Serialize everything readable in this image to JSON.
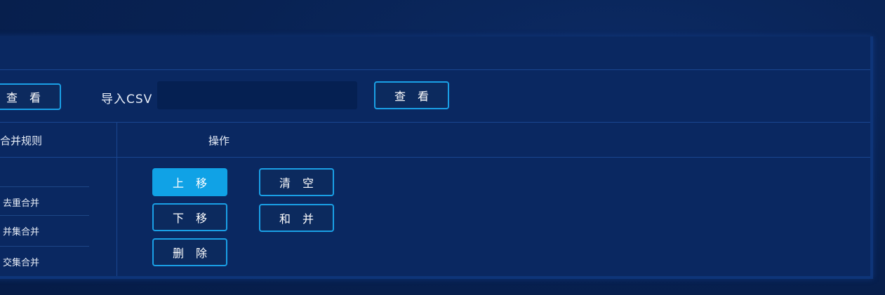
{
  "toolbar": {
    "view_left_label": "查 看",
    "import_label": "导入CSV",
    "import_value": "",
    "view_right_label": "查 看"
  },
  "table": {
    "rule_header": "合并规则",
    "ops_header": "操作"
  },
  "rules": [
    "去重合并",
    "并集合并",
    "交集合并"
  ],
  "ops": {
    "move_up": "上 移",
    "clear": "清 空",
    "move_down": "下 移",
    "merge": "和 并",
    "delete": "删 除"
  },
  "colors": {
    "accent": "#10a2e6",
    "panel": "#0a2861",
    "background": "#082253",
    "input": "#052052"
  }
}
